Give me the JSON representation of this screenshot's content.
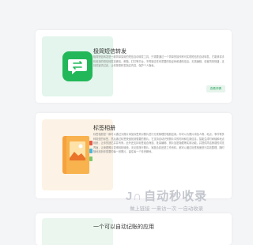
{
  "cards": [
    {
      "title": "极简短信转发",
      "icon": "message-transfer-icon",
      "accent": "#22b85a",
      "description": "极简短信转发是一款简单易用的短信自动转发工具，只需要通过一个简单的操作即可实现短信的自动转发。它能够将手机收到的短信转发至微信、邮箱、钉钉等平台，不再错过任何重要的验证码和通知信息。无需编程，设置简单快捷，支持关键词过滤，让你按需转发指定内容，保护个人隐私。",
      "button_label": "查看详情"
    },
    {
      "title": "标签相册",
      "icon": "photo-album-icon",
      "accent": "#f39c2b",
      "description": "标签相册是一款可以通过为照片添加标签来对照片进行分类管理的相册应用。你可以为照片添加人物、地点、事件等多种类型的标签，然后通过标签快速找到想要的照片。它支持自动识别照片中的时间和位置信息，智能生成时间轴和地点相册，让你的回忆井井有条。此外还支持标签组合筛选、批量编辑、照片加密隐藏等实用功能，并提供简洁美观的浏览界面，让管理照片变得轻松愉快。无论是旅行照片、家庭合影还是工作资料，都可以通过标签相册进行高效整理，随时随地找到你需要的每一张照片，留住每一个珍贵瞬间。"
    },
    {
      "title": "一个可以自动记账的应用",
      "icon": "bookkeeping-icon",
      "accent": "#22b85a"
    }
  ],
  "watermark": {
    "logo_text": "自动秒收录",
    "tagline": "做上链接 一来访一次 一自动收录"
  }
}
